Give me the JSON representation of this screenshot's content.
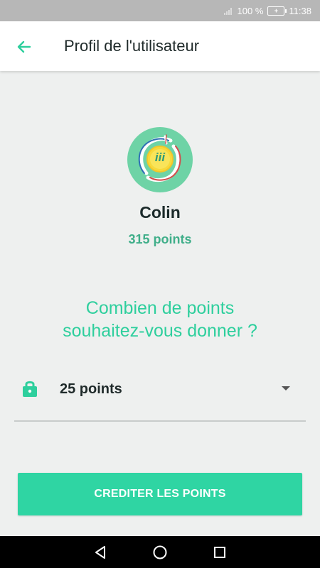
{
  "status_bar": {
    "battery_percent": "100 %",
    "time": "11:38",
    "battery_label": "+",
    "icons": [
      "signal-icon",
      "battery-icon"
    ]
  },
  "app_bar": {
    "back_icon": "arrow-left-icon",
    "title": "Profil de l'utilisateur"
  },
  "profile": {
    "avatar_icon": "medal-icon",
    "avatar_text": "iii",
    "name": "Colin",
    "points": "315 points"
  },
  "donation": {
    "question_line1": "Combien de points",
    "question_line2": "souhaitez-vous donner ?",
    "select_icon": "lock-icon",
    "selected_value": "25 points",
    "dropdown_icon": "chevron-down-icon"
  },
  "cta": {
    "label": "CREDITER LES POINTS"
  },
  "nav": {
    "icons": [
      "back-triangle-icon",
      "home-circle-icon",
      "recents-square-icon"
    ]
  },
  "colors": {
    "accent": "#2fd5a3",
    "points_text": "#3fae89",
    "question_text": "#2ecf9d",
    "background": "#eef0ef"
  }
}
